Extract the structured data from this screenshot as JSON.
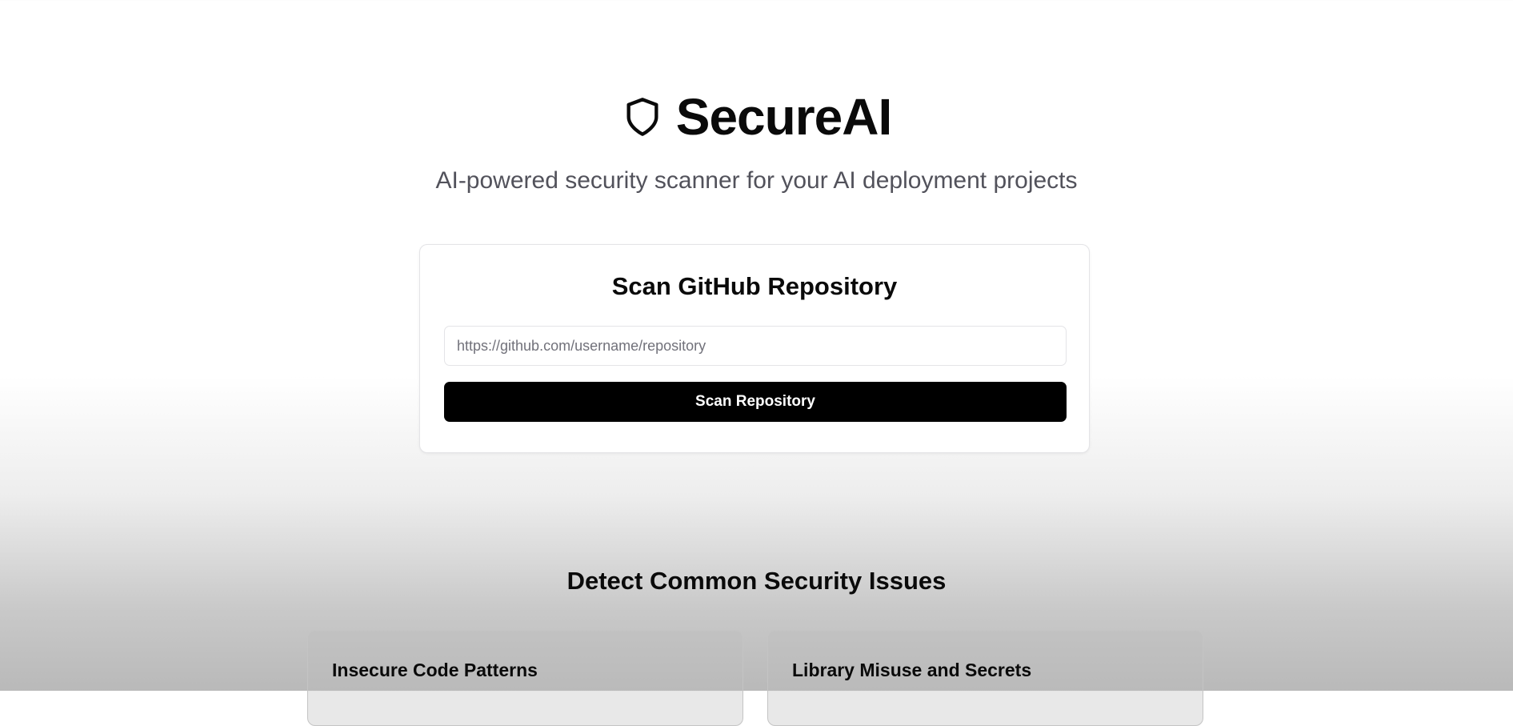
{
  "brand": {
    "title": "SecureAI",
    "icon": "shield-icon"
  },
  "tagline": "AI-powered security scanner for your AI deployment projects",
  "scan": {
    "title": "Scan GitHub Repository",
    "input_placeholder": "https://github.com/username/repository",
    "input_value": "",
    "button_label": "Scan Repository"
  },
  "features": {
    "title": "Detect Common Security Issues",
    "cards": [
      {
        "title": "Insecure Code Patterns"
      },
      {
        "title": "Library Misuse and Secrets"
      }
    ]
  },
  "colors": {
    "primary": "#000000",
    "text": "#0a0a0a",
    "muted": "#52525b",
    "border": "#e4e4e7"
  }
}
